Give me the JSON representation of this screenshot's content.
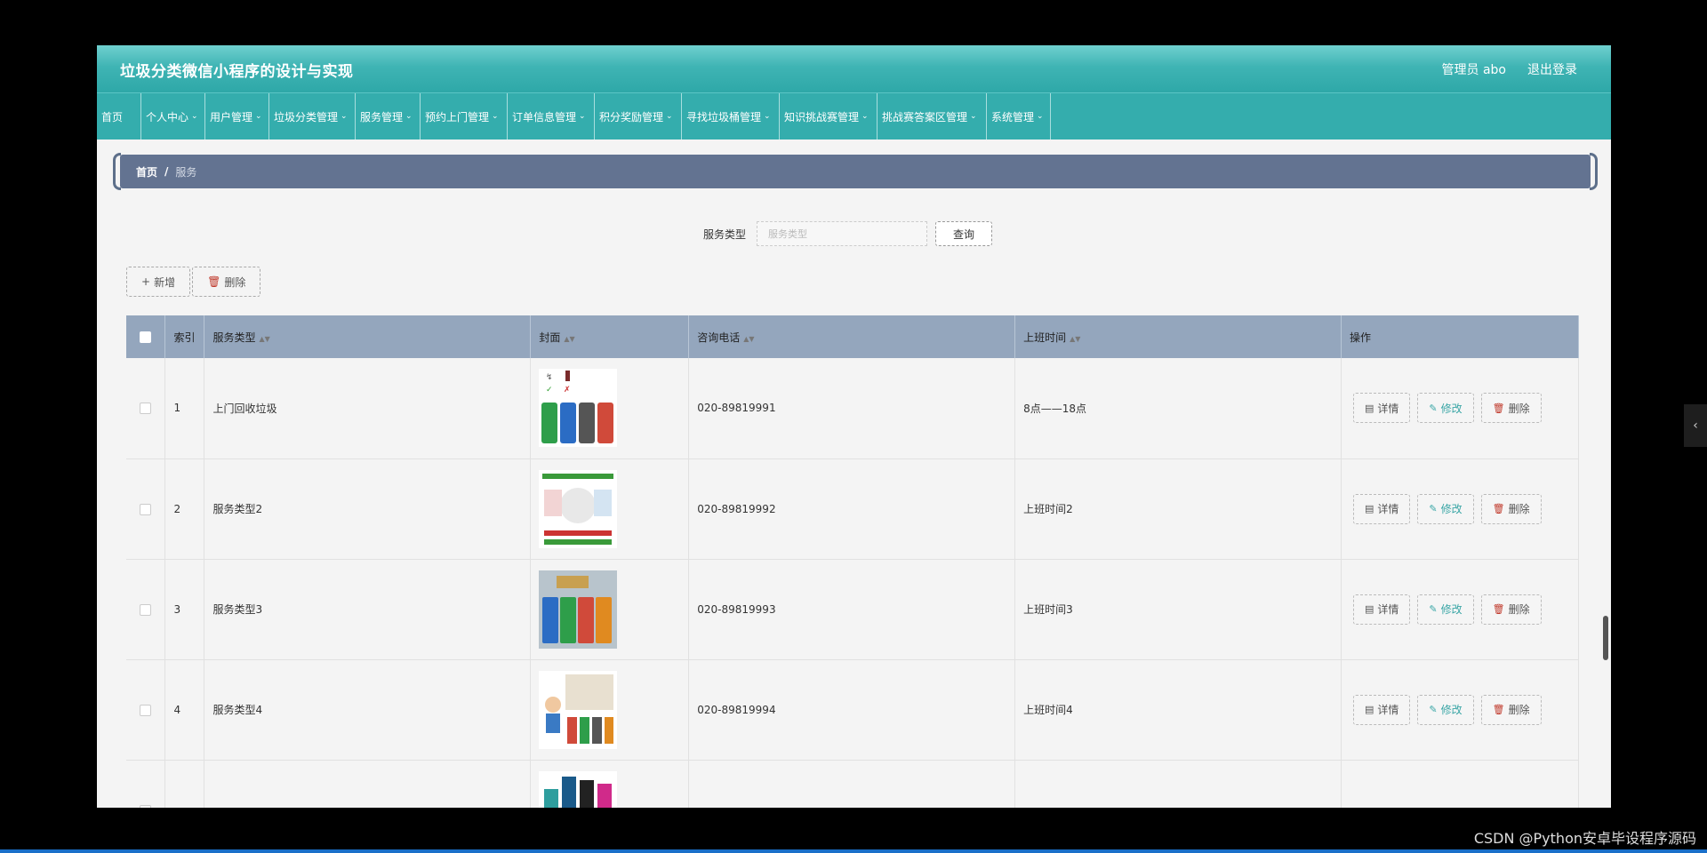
{
  "app": {
    "title": "垃圾分类微信小程序的设计与实现",
    "user_label": "管理员 abo",
    "logout_label": "退出登录"
  },
  "nav": [
    {
      "label": "首页",
      "dropdown": false
    },
    {
      "label": "个人中心",
      "dropdown": true
    },
    {
      "label": "用户管理",
      "dropdown": true
    },
    {
      "label": "垃圾分类管理",
      "dropdown": true
    },
    {
      "label": "服务管理",
      "dropdown": true
    },
    {
      "label": "预约上门管理",
      "dropdown": true
    },
    {
      "label": "订单信息管理",
      "dropdown": true
    },
    {
      "label": "积分奖励管理",
      "dropdown": true
    },
    {
      "label": "寻找垃圾桶管理",
      "dropdown": true
    },
    {
      "label": "知识挑战赛管理",
      "dropdown": true
    },
    {
      "label": "挑战赛答案区管理",
      "dropdown": true
    },
    {
      "label": "系统管理",
      "dropdown": true
    }
  ],
  "breadcrumb": {
    "home": "首页",
    "sep": "/",
    "current": "服务"
  },
  "search": {
    "label": "服务类型",
    "placeholder": "服务类型",
    "button": "查询"
  },
  "toolbar": {
    "add_label": "新增",
    "delete_label": "删除"
  },
  "table": {
    "headers": {
      "index": "索引",
      "type": "服务类型",
      "cover": "封面",
      "phone": "咨询电话",
      "hours": "上班时间",
      "ops": "操作"
    },
    "rows": [
      {
        "index": "1",
        "type": "上门回收垃圾",
        "phone": "020-89819991",
        "hours": "8点——18点"
      },
      {
        "index": "2",
        "type": "服务类型2",
        "phone": "020-89819992",
        "hours": "上班时间2"
      },
      {
        "index": "3",
        "type": "服务类型3",
        "phone": "020-89819993",
        "hours": "上班时间3"
      },
      {
        "index": "4",
        "type": "服务类型4",
        "phone": "020-89819994",
        "hours": "上班时间4"
      }
    ],
    "ops": {
      "detail": "详情",
      "edit": "修改",
      "delete": "删除"
    }
  },
  "watermark": "CSDN @Python安卓毕设程序源码"
}
